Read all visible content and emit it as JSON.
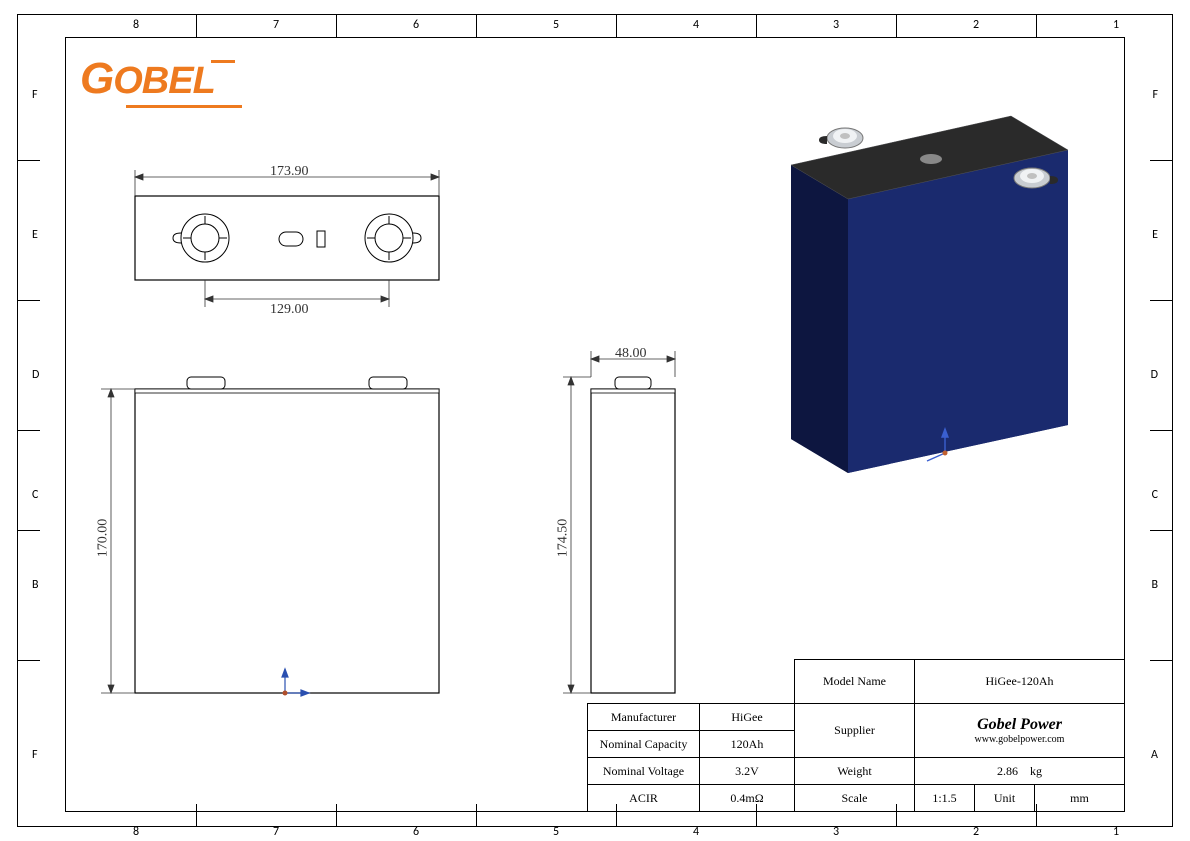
{
  "logo_text": "Gobel",
  "zones_top": [
    "8",
    "7",
    "6",
    "5",
    "4",
    "3",
    "2",
    "1"
  ],
  "zones_bottom": [
    "8",
    "7",
    "6",
    "5",
    "4",
    "3",
    "2",
    "1"
  ],
  "zones_left": [
    "F",
    "E",
    "D",
    "C",
    "B",
    "F"
  ],
  "zones_right": [
    "F",
    "E",
    "D",
    "C",
    "B",
    "A"
  ],
  "dimensions": {
    "width_total": "173.90",
    "terminal_pitch": "129.00",
    "side_width": "48.00",
    "body_height": "170.00",
    "overall_height": "174.50"
  },
  "titleblock": {
    "model_label": "Model Name",
    "model_value": "HiGee-120Ah",
    "manufacturer_label": "Manufacturer",
    "manufacturer_value": "HiGee",
    "supplier_label": "Supplier",
    "supplier_name": "Gobel Power",
    "supplier_url": "www.gobelpower.com",
    "capacity_label": "Nominal Capacity",
    "capacity_value": "120Ah",
    "voltage_label": "Nominal Voltage",
    "voltage_value": "3.2V",
    "weight_label": "Weight",
    "weight_value": "2.86",
    "weight_unit": "kg",
    "acir_label": "ACIR",
    "acir_value": "0.4mΩ",
    "scale_label": "Scale",
    "scale_value": "1:1.5",
    "unit_label": "Unit",
    "unit_value": "mm"
  }
}
